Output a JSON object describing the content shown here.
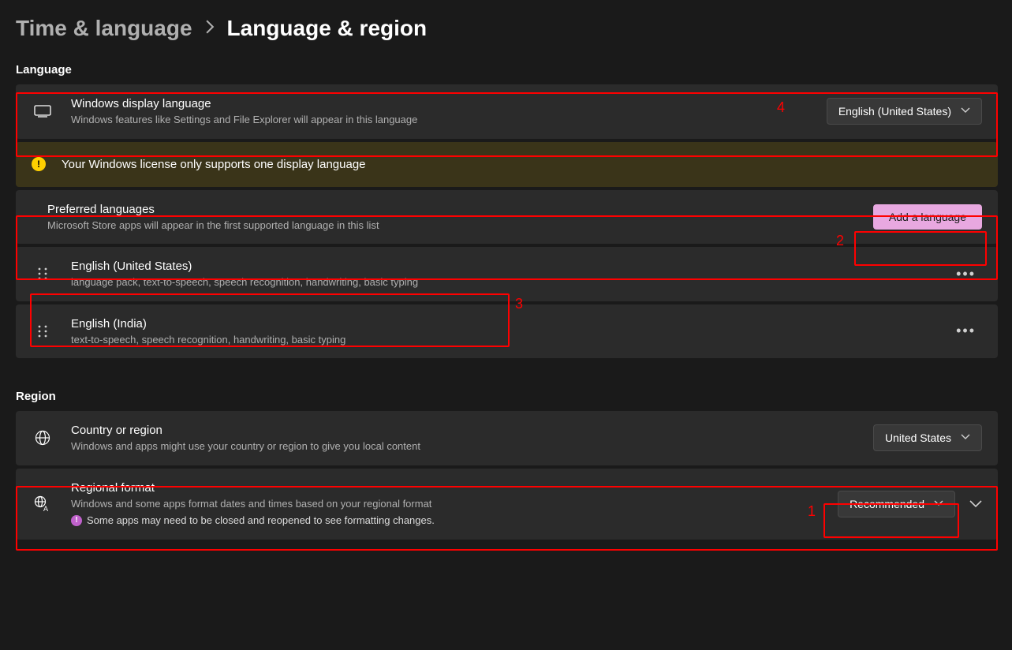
{
  "breadcrumb": {
    "parent": "Time & language",
    "current": "Language & region"
  },
  "sections": {
    "language_heading": "Language",
    "region_heading": "Region"
  },
  "display_language": {
    "title": "Windows display language",
    "desc": "Windows features like Settings and File Explorer will appear in this language",
    "selected": "English (United States)"
  },
  "license_warning": "Your Windows license only supports one display language",
  "preferred": {
    "title": "Preferred languages",
    "desc": "Microsoft Store apps will appear in the first supported language in this list",
    "add_button": "Add a language",
    "items": [
      {
        "name": "English (United States)",
        "features": "language pack, text-to-speech, speech recognition, handwriting, basic typing"
      },
      {
        "name": "English (India)",
        "features": "text-to-speech, speech recognition, handwriting, basic typing"
      }
    ]
  },
  "country": {
    "title": "Country or region",
    "desc": "Windows and apps might use your country or region to give you local content",
    "selected": "United States"
  },
  "regional_format": {
    "title": "Regional format",
    "desc": "Windows and some apps format dates and times based on your regional format",
    "note": "Some apps may need to be closed and reopened to see formatting changes.",
    "selected": "Recommended"
  },
  "annotations": {
    "a1": "1",
    "a2": "2",
    "a3": "3",
    "a4": "4"
  }
}
